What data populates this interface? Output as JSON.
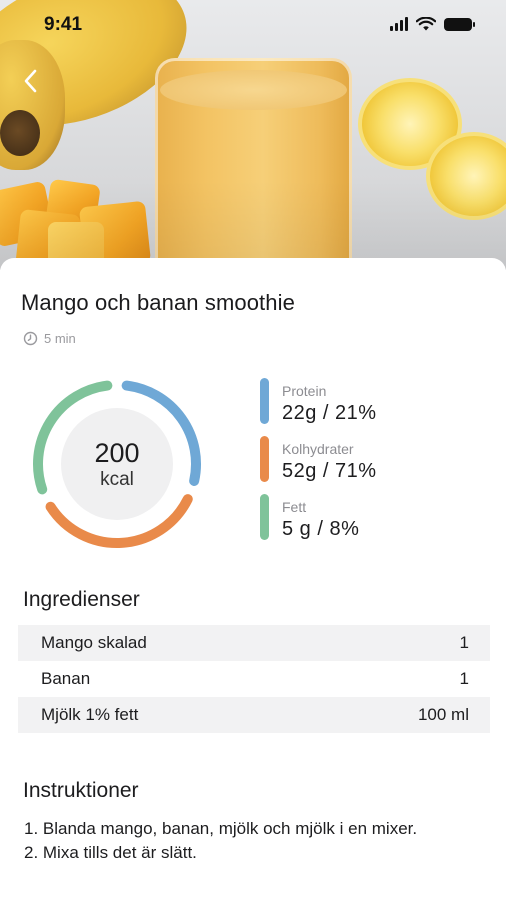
{
  "status_bar": {
    "time": "9:41"
  },
  "hero": {
    "image": "mango-banana-smoothie-photo"
  },
  "nav": {
    "back_icon": "chevron-left-icon"
  },
  "recipe": {
    "title": "Mango och banan smoothie",
    "prep_time": "5 min",
    "calories": {
      "value": "200",
      "unit": "kcal"
    },
    "macros": [
      {
        "name": "Protein",
        "value": "22g / 21%",
        "percent": 21,
        "color": "#6fa8d6"
      },
      {
        "name": "Kolhydrater",
        "value": "52g / 71%",
        "percent": 71,
        "color": "#e98a4a"
      },
      {
        "name": "Fett",
        "value": "5 g / 8%",
        "percent": 8,
        "color": "#7fc39a"
      }
    ]
  },
  "ingredients": {
    "title": "Ingredienser",
    "items": [
      {
        "name": "Mango skalad",
        "amount": "1"
      },
      {
        "name": "Banan",
        "amount": "1"
      },
      {
        "name": "Mjölk 1% fett",
        "amount": "100 ml"
      }
    ]
  },
  "instructions": {
    "title": "Instruktioner",
    "steps": [
      "1. Blanda mango, banan, mjölk och mjölk i en mixer.",
      "2. Mixa tills det är slätt."
    ]
  }
}
